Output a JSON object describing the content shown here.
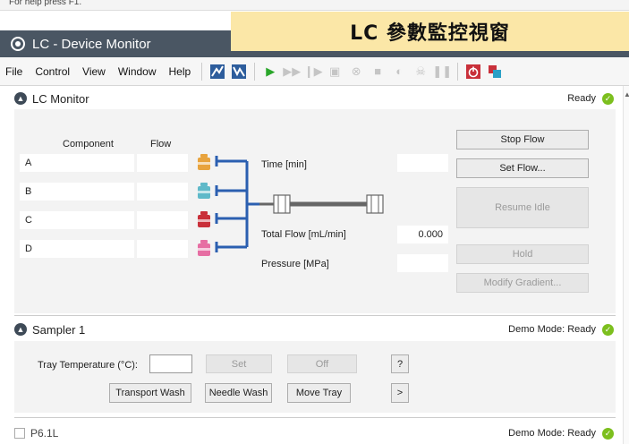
{
  "help_text": "For help press F1.",
  "banner": "LC 參數監控視窗",
  "window": {
    "title": "LC - Device Monitor"
  },
  "menu": [
    "File",
    "Control",
    "View",
    "Window",
    "Help"
  ],
  "toolbar_icons": [
    "chart-up-icon",
    "chart-alt-icon",
    "play-icon",
    "fast-forward-icon",
    "step-icon",
    "camera-icon",
    "stop-circle-icon",
    "square-stop-icon",
    "sequence-icon",
    "sampler-icon",
    "pause-icon",
    "power-icon",
    "network-icon"
  ],
  "lc_monitor": {
    "name": "LC Monitor",
    "status": "Ready",
    "col_component": "Component",
    "col_flow": "Flow",
    "components": [
      {
        "label": "A",
        "flow": "",
        "color": "#e8a33d"
      },
      {
        "label": "B",
        "flow": "",
        "color": "#5fb9c9"
      },
      {
        "label": "C",
        "flow": "",
        "color": "#c9303a"
      },
      {
        "label": "D",
        "flow": "",
        "color": "#e66ea3"
      }
    ],
    "time_label": "Time [min]",
    "time_value": "",
    "total_flow_label": "Total Flow [mL/min]",
    "total_flow_value": "0.000",
    "pressure_label": "Pressure [MPa]",
    "pressure_value": "",
    "buttons": {
      "stop_flow": "Stop Flow",
      "set_flow": "Set Flow...",
      "resume_idle": "Resume Idle",
      "hold": "Hold",
      "modify_gradient": "Modify Gradient..."
    }
  },
  "sampler": {
    "name": "Sampler 1",
    "status": "Demo Mode: Ready",
    "tray_temp_label": "Tray Temperature (°C):",
    "tray_temp_value": "",
    "set": "Set",
    "off": "Off",
    "help": "?",
    "transport_wash": "Transport Wash",
    "needle_wash": "Needle Wash",
    "move_tray": "Move Tray",
    "more": ">"
  },
  "p61l": {
    "name": "P6.1L",
    "status": "Demo Mode: Ready"
  },
  "colors": {
    "titlebar": "#4a5663",
    "banner": "#fbe7a7",
    "flow_lines": "#2b5fb0",
    "check": "#7cbf1e"
  }
}
